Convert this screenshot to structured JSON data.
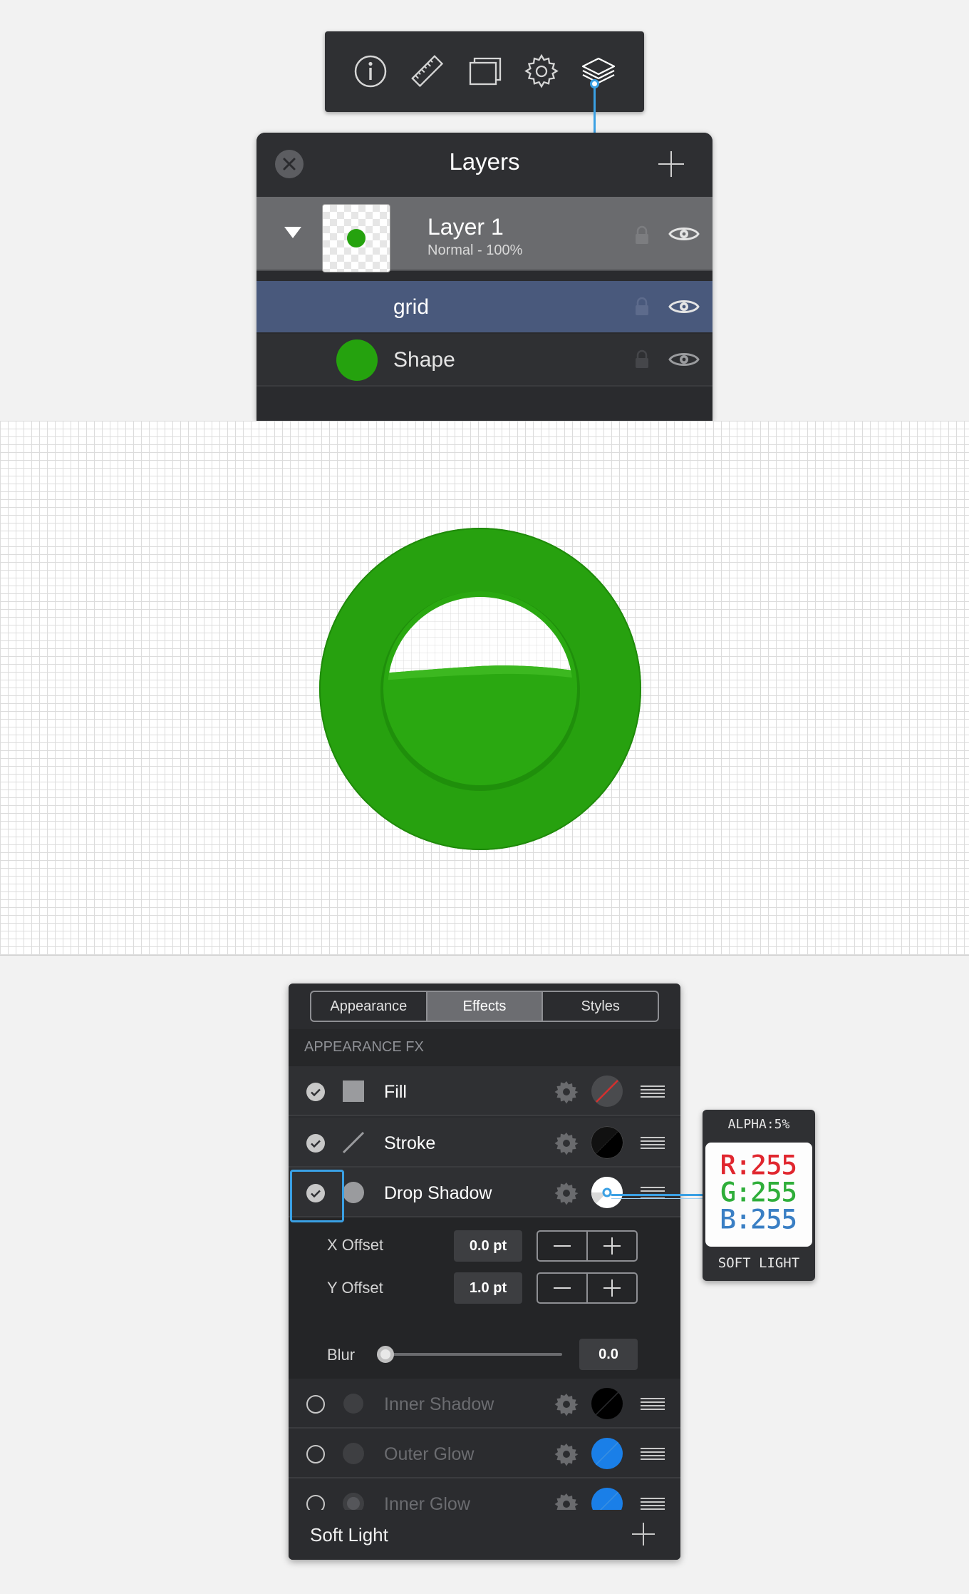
{
  "toolbar": {
    "icons": [
      "info-icon",
      "ruler-icon",
      "artboard-icon",
      "gear-icon",
      "layers-icon"
    ],
    "active": "layers-icon"
  },
  "layers_panel": {
    "title": "Layers",
    "group": {
      "name": "Layer 1",
      "subtitle": "Normal - 100%"
    },
    "items": [
      {
        "name": "grid",
        "selected": true
      },
      {
        "name": "Shape",
        "selected": false
      }
    ]
  },
  "canvas": {
    "accent": "#25a20e"
  },
  "appearance_panel": {
    "tabs": [
      {
        "label": "Appearance",
        "active": false
      },
      {
        "label": "Effects",
        "active": true
      },
      {
        "label": "Styles",
        "active": false
      }
    ],
    "section_title": "APPEARANCE FX",
    "effects": [
      {
        "label": "Fill",
        "enabled": true
      },
      {
        "label": "Stroke",
        "enabled": true
      },
      {
        "label": "Drop Shadow",
        "enabled": true
      },
      {
        "label": "Inner Shadow",
        "enabled": false
      },
      {
        "label": "Outer Glow",
        "enabled": false
      },
      {
        "label": "Inner Glow",
        "enabled": false
      }
    ],
    "options": {
      "x_offset_label": "X Offset",
      "x_offset_value": "0.0 pt",
      "y_offset_label": "Y Offset",
      "y_offset_value": "1.0 pt",
      "blur_label": "Blur",
      "blur_value": "0.0"
    },
    "footer_label": "Soft Light"
  },
  "color_tooltip": {
    "alpha": "ALPHA:5%",
    "r": "R:255",
    "g": "G:255",
    "b": "B:255",
    "blend_mode": "SOFT LIGHT",
    "colors": {
      "r": "#e0262e",
      "g": "#2fae3a",
      "b": "#3a7fc4"
    }
  }
}
